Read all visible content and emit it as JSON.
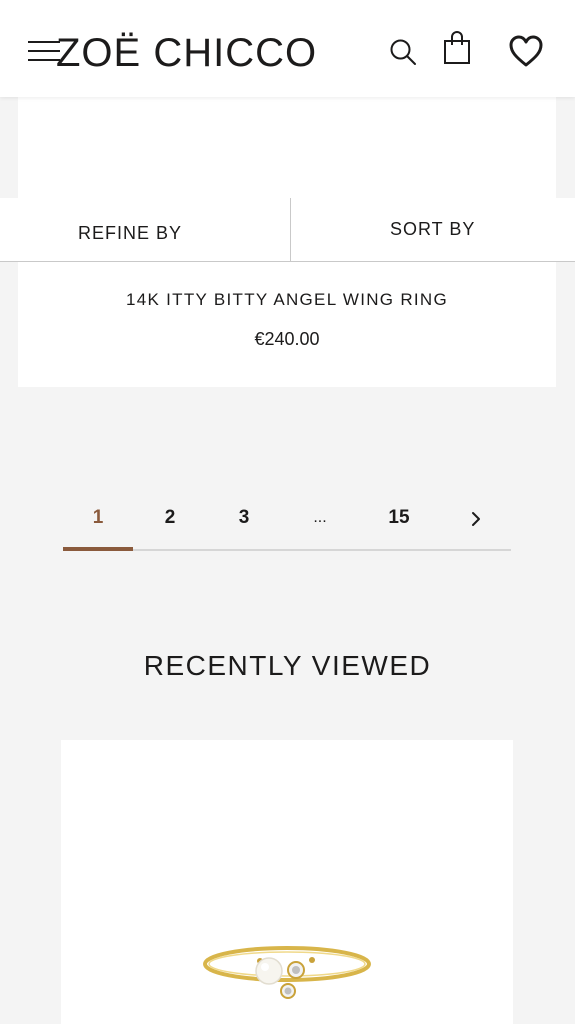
{
  "header": {
    "brand": "ZOË CHICCO",
    "icons": [
      "menu-icon",
      "search-icon",
      "shopping-bag-icon",
      "heart-icon"
    ]
  },
  "filters": {
    "refine_label": "REFINE BY",
    "sort_label": "SORT BY"
  },
  "product": {
    "name": "14K ITTY BITTY ANGEL WING RING",
    "price": "€240.00"
  },
  "pagination": {
    "pages": [
      "1",
      "2",
      "3",
      "...",
      "15"
    ],
    "current": "1",
    "next_icon": "chevron-right-icon"
  },
  "recently_viewed": {
    "title": "RECENTLY VIEWED",
    "item_image": "gold-pearl-diamond-ring"
  },
  "colors": {
    "accent": "#8a5a3c",
    "text": "#1c1b1b",
    "background": "#f4f4f4",
    "card": "#ffffff",
    "ring_gold": "#d8b54a"
  }
}
